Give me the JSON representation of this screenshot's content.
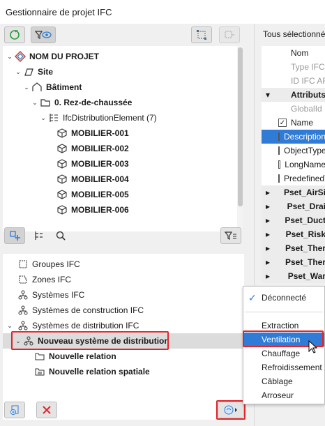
{
  "window": {
    "title": "Gestionnaire de projet IFC"
  },
  "tree": {
    "items": [
      {
        "label": "NOM DU PROJET",
        "bold": true
      },
      {
        "label": "Site",
        "bold": true
      },
      {
        "label": "Bâtiment",
        "bold": true
      },
      {
        "label": "0. Rez-de-chaussée",
        "bold": true
      },
      {
        "label": "IfcDistributionElement (7)",
        "bold": false
      },
      {
        "label": "MOBILIER-001",
        "bold": true
      },
      {
        "label": "MOBILIER-002",
        "bold": true
      },
      {
        "label": "MOBILIER-003",
        "bold": true
      },
      {
        "label": "MOBILIER-004",
        "bold": true
      },
      {
        "label": "MOBILIER-005",
        "bold": true
      },
      {
        "label": "MOBILIER-006",
        "bold": true
      }
    ]
  },
  "lower": {
    "items": [
      {
        "label": "Groupes IFC"
      },
      {
        "label": "Zones IFC"
      },
      {
        "label": "Systèmes IFC"
      },
      {
        "label": "Systèmes de construction IFC"
      },
      {
        "label": "Systèmes de distribution IFC"
      },
      {
        "label": "Nouveau système de distribution"
      },
      {
        "label": "Nouvelle relation"
      },
      {
        "label": "Nouvelle relation spatiale"
      }
    ]
  },
  "right": {
    "header": "Tous sélectionnés",
    "rows": [
      {
        "label": "Nom"
      },
      {
        "label": "Type IFC"
      },
      {
        "label": "ID IFC ARC"
      },
      {
        "label": "Attributs"
      },
      {
        "label": "GlobalId"
      },
      {
        "label": "Name"
      },
      {
        "label": "Description"
      },
      {
        "label": "ObjectType"
      },
      {
        "label": "LongName"
      },
      {
        "label": "PredefinedType"
      },
      {
        "label": "Pset_AirSi"
      },
      {
        "label": "Pset_Drai"
      },
      {
        "label": "Pset_Duct"
      },
      {
        "label": "Pset_Risk"
      },
      {
        "label": "Pset_Ther"
      },
      {
        "label": "Pset_Ther"
      },
      {
        "label": "Pset_War"
      }
    ]
  },
  "menu": {
    "disconnected": "Déconnecté",
    "items": [
      "Extraction",
      "Ventilation",
      "Chauffage",
      "Refroidissement",
      "Câblage",
      "Arroseur"
    ]
  },
  "colors": {
    "accent": "#2f7bd6",
    "highlight_box": "#e0262a",
    "refresh_green": "#2a9d3a"
  }
}
